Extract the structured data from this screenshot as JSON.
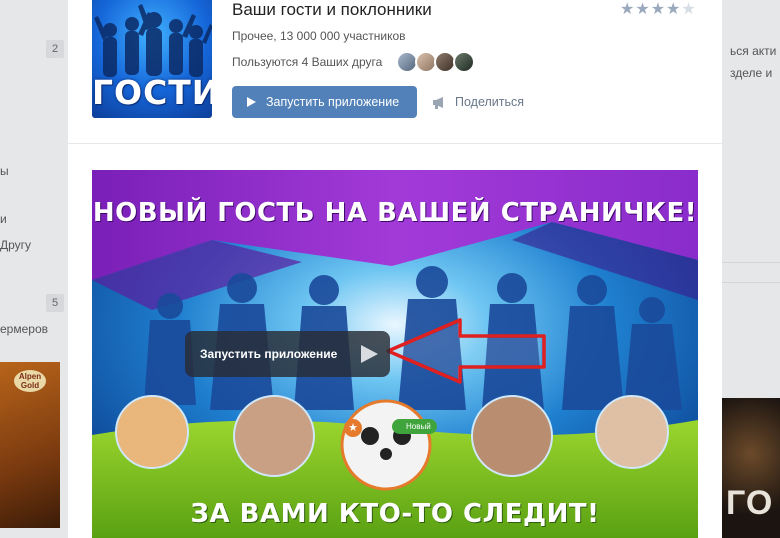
{
  "background_page": {
    "left_badges": [
      "2",
      "5"
    ],
    "left_texts": [
      "ы",
      "и",
      "Другу",
      "ермеров"
    ],
    "right_texts": [
      "ься акти",
      "зделе и"
    ],
    "left_thumb_brand": "Alpen Gold",
    "right_thumb_text": "ГО"
  },
  "app": {
    "logo_label": "ГОСТИ",
    "title": "Ваши гости и поклонники",
    "rating": {
      "filled": 4,
      "total": 5
    },
    "meta": "Прочее, 13 000 000 участников",
    "friends_text": "Пользуются 4 Ваших друга",
    "friend_avatar_colors": [
      "#7c8fa5",
      "#b59a86",
      "#6b5a4f",
      "#3d4a3f"
    ],
    "run_button": "Запустить приложение",
    "share_button": "Поделиться",
    "accent_color": "#5181b8"
  },
  "banner": {
    "headline": "НОВЫЙ ГОСТЬ НА ВАШЕЙ СТРАНИЧКЕ!",
    "footline": "ЗА ВАМИ КТО-ТО СЛЕДИТ!",
    "overlay_button": "Запустить приложение",
    "new_badge": "Новый",
    "arrow_color": "#e02020"
  }
}
